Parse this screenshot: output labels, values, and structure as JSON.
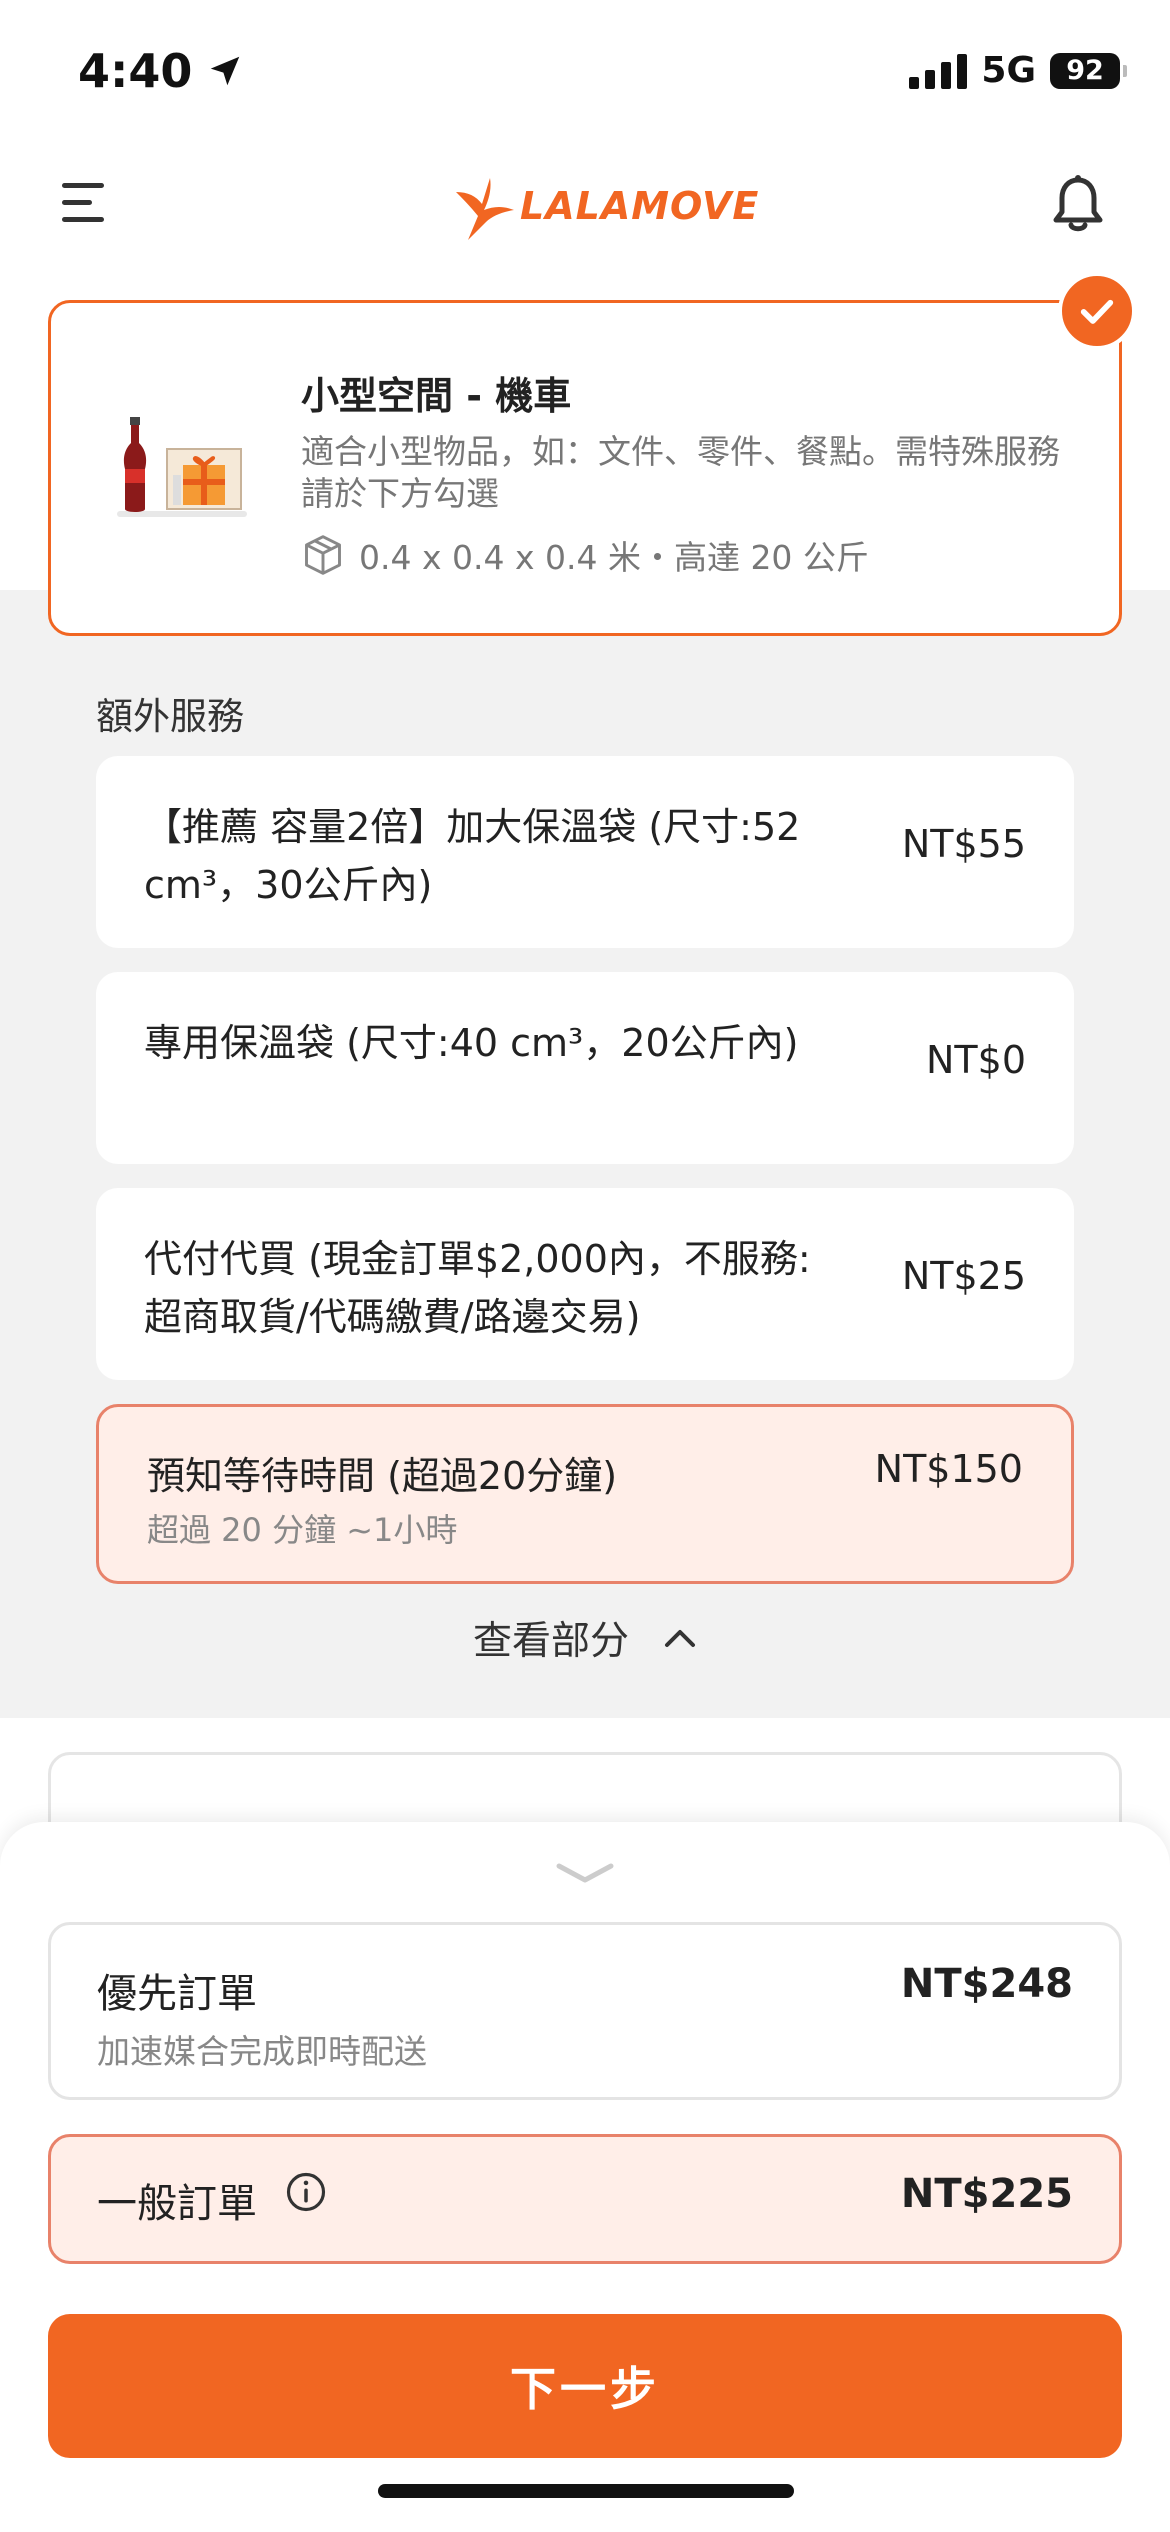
{
  "status_bar": {
    "time": "4:40",
    "network": "5G",
    "battery": "92"
  },
  "header": {
    "logo_text": "LALAMOVE"
  },
  "vehicle": {
    "title": "小型空間 - 機車",
    "description": "適合小型物品，如：文件、零件、餐點。需特殊服務請於下方勾選",
    "dimensions": "0.4 x 0.4 x 0.4 米・高達 20 公斤"
  },
  "extra_services": {
    "title": "額外服務",
    "items": [
      {
        "label": "【推薦 容量2倍】加大保溫袋 (尺寸:52 cm³，30公斤內)",
        "price": "NT$55"
      },
      {
        "label": "專用保溫袋 (尺寸:40 cm³，20公斤內)",
        "price": "NT$0"
      },
      {
        "label": "代付代買 (現金訂單$2,000內，不服務: 超商取貨/代碼繳費/路邊交易)",
        "price": "NT$25"
      },
      {
        "label": "預知等待時間 (超過20分鐘)",
        "sub": "超過 20 分鐘 ~1小時",
        "price": "NT$150"
      }
    ],
    "toggle_label": "查看部分"
  },
  "order_options": {
    "priority": {
      "name": "優先訂單",
      "sub": "加速媒合完成即時配送",
      "price": "NT$248"
    },
    "normal": {
      "name": "一般訂單",
      "price": "NT$225"
    }
  },
  "next_button": {
    "label": "下一步"
  },
  "colors": {
    "brand_orange": "#F16622",
    "selected_bg": "#FFEEE8",
    "selected_border": "#E8826A"
  }
}
